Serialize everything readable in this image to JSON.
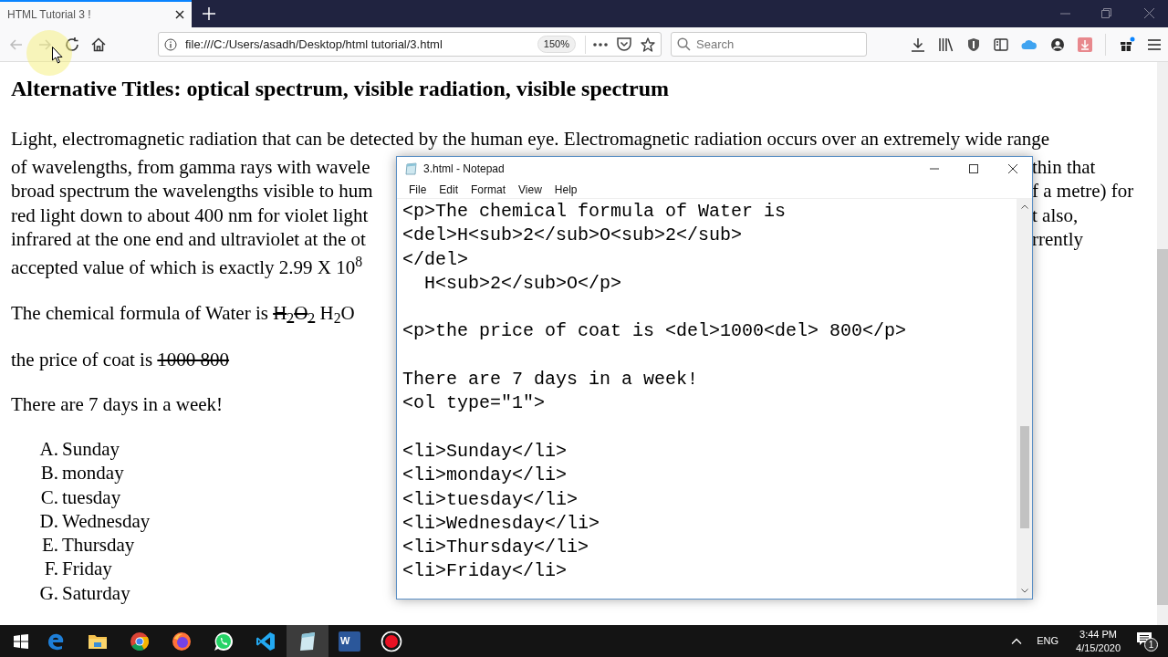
{
  "browser": {
    "tabs": [
      {
        "title": "HTML Tutorial 3 !",
        "selected": true
      }
    ],
    "url": "file:///C:/Users/asadh/Desktop/html tutorial/3.html",
    "zoom": "150%",
    "search": {
      "placeholder": "Search"
    }
  },
  "page": {
    "heading": "Alternative Titles: optical spectrum, visible radiation, visible spectrum",
    "paragraph_lines": [
      {
        "left": "Light, electromagnetic radiation that can be detected by the human eye. Electromagnetic radiation occurs over an extremely wide range"
      },
      {
        "left": "of wavelengths, from gamma rays with wavele",
        "right": "thin that"
      },
      {
        "left": "broad spectrum the wavelengths visible to hum",
        "right": "f a metre) for"
      },
      {
        "left": "red light down to about 400 nm for violet light",
        "right": "t also,"
      },
      {
        "left": "infrared at the one end and ultraviolet at the ot",
        "right": "rrently"
      },
      {
        "left": "accepted value of which is exactly 2.99 X 10$^{8}$"
      }
    ],
    "formula": {
      "text": "The chemical formula of Water is",
      "deleted": "H$_{2}$O$_{2}$",
      "current": "H$_{2}$O"
    },
    "price": {
      "text": "the price of coat is",
      "deleted": "1000 800"
    },
    "days": "There are 7 days in a week!",
    "list": [
      {
        "marker": "A.",
        "text": "Sunday"
      },
      {
        "marker": "B.",
        "text": "monday"
      },
      {
        "marker": "C.",
        "text": "tuesday"
      },
      {
        "marker": "D.",
        "text": "Wednesday"
      },
      {
        "marker": "E.",
        "text": "Thursday"
      },
      {
        "marker": "F.",
        "text": "Friday"
      },
      {
        "marker": "G.",
        "text": "Saturday"
      }
    ]
  },
  "notepad": {
    "title": "3.html - Notepad",
    "menu": [
      "File",
      "Edit",
      "Format",
      "View",
      "Help"
    ],
    "blocks": [
      [
        "<p>The chemical formula of Water is",
        "<del>H<sub>2</sub>O<sub>2</sub>",
        "</del>",
        "  H<sub>2</sub>O</p>"
      ],
      [
        "<p>the price of coat is <del>1000<del> 800</p>"
      ],
      [
        "There are 7 days in a week!",
        "<ol type=\"1\">"
      ],
      [
        "<li>Sunday</li>",
        "<li>monday</li>",
        "<li>tuesday</li>",
        "<li>Wednesday</li>",
        "<li>Thursday</li>",
        "<li>Friday</li>"
      ]
    ]
  },
  "taskbar": {
    "apps": [
      {
        "kind": "edge",
        "selected": false
      },
      {
        "kind": "folder",
        "selected": false
      },
      {
        "kind": "chrome",
        "selected": false
      },
      {
        "kind": "firefox",
        "selected": false
      },
      {
        "kind": "whatsapp",
        "selected": false
      },
      {
        "kind": "vscode",
        "selected": false
      },
      {
        "kind": "notepad",
        "selected": true
      },
      {
        "kind": "word",
        "selected": false,
        "label": "W"
      },
      {
        "kind": "record",
        "selected": false
      }
    ],
    "language": "ENG",
    "time": "3:44 PM",
    "date": "4/15/2020",
    "notifications": "1"
  }
}
